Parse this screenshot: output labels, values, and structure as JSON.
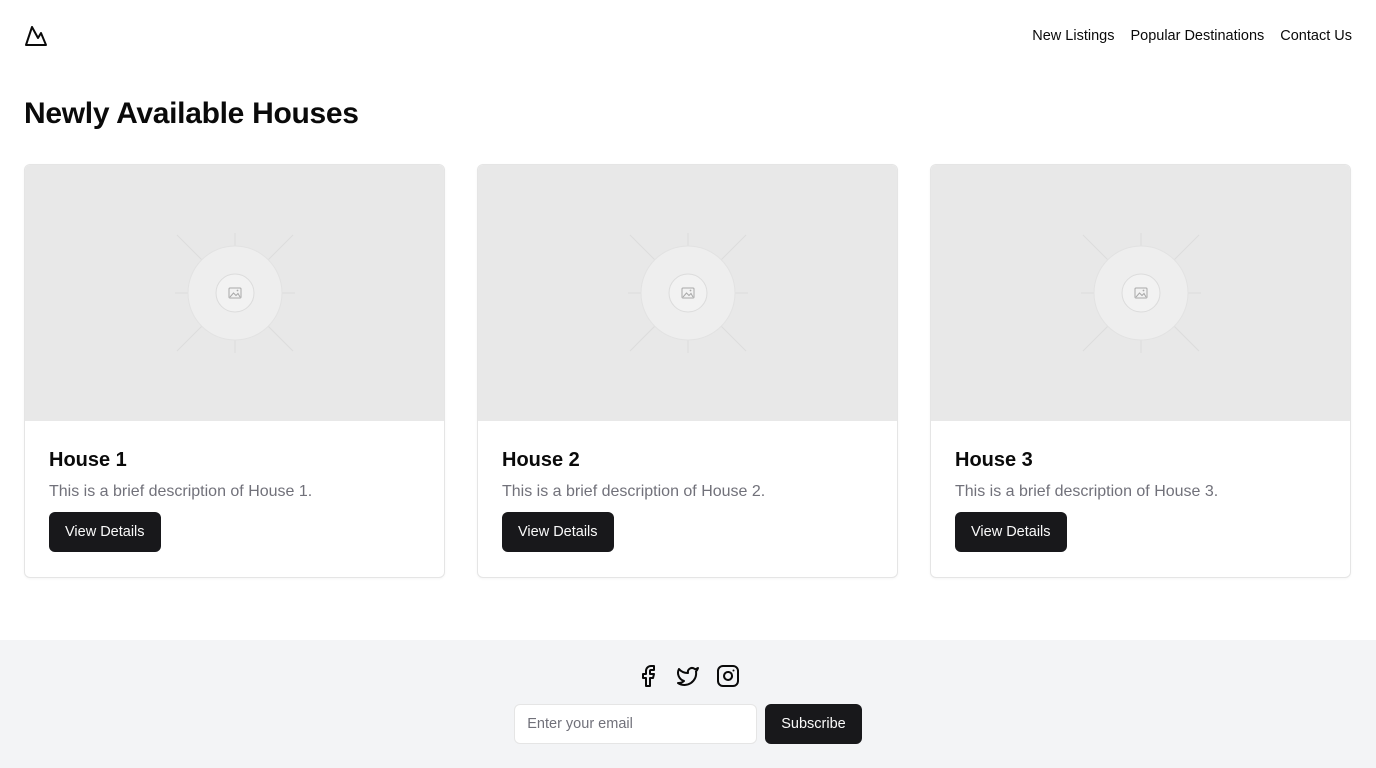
{
  "header": {
    "logo_icon": "mountain-icon",
    "nav": [
      {
        "label": "New Listings"
      },
      {
        "label": "Popular Destinations"
      },
      {
        "label": "Contact Us"
      }
    ]
  },
  "main": {
    "title": "Newly Available Houses",
    "cards": [
      {
        "title": "House 1",
        "description": "This is a brief description of House 1.",
        "button_label": "View Details",
        "image_icon": "image-placeholder-icon"
      },
      {
        "title": "House 2",
        "description": "This is a brief description of House 2.",
        "button_label": "View Details",
        "image_icon": "image-placeholder-icon"
      },
      {
        "title": "House 3",
        "description": "This is a brief description of House 3.",
        "button_label": "View Details",
        "image_icon": "image-placeholder-icon"
      }
    ]
  },
  "footer": {
    "socials": [
      "facebook-icon",
      "twitter-icon",
      "instagram-icon"
    ],
    "email_placeholder": "Enter your email",
    "subscribe_label": "Subscribe"
  },
  "colors": {
    "primary_button": "#18181b",
    "footer_bg": "#f3f4f6",
    "image_placeholder_bg": "#e8e8e8",
    "muted_text": "#71717a"
  }
}
